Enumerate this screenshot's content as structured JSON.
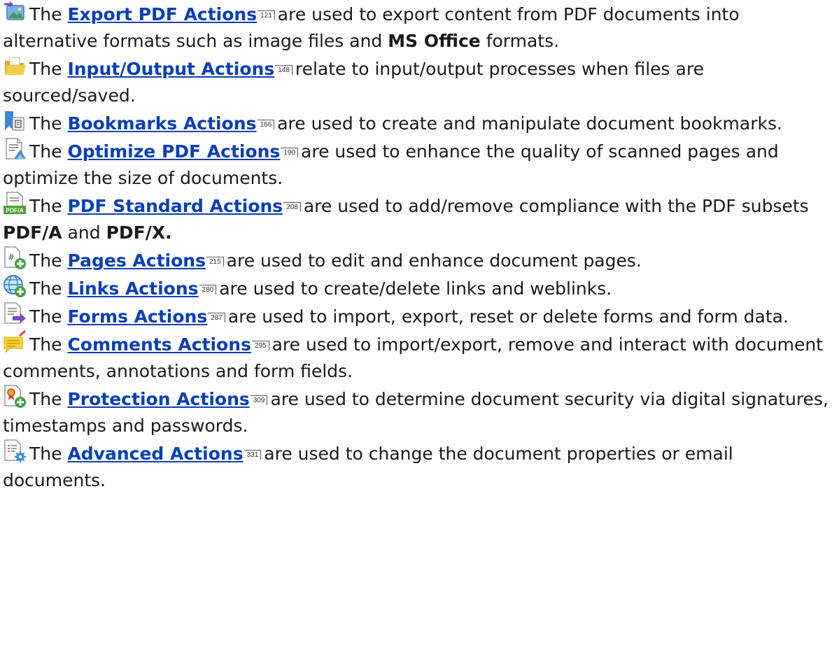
{
  "entries": [
    {
      "icon": "export-pdf-icon",
      "pre": "The ",
      "link": "Export PDF Actions",
      "page": "121",
      "text_a": "are used to export content from PDF documents into alternative formats such as image files and ",
      "bold_a": "MS Office",
      "text_b": " formats."
    },
    {
      "icon": "folder-icon",
      "pre": "The ",
      "link": "Input/Output Actions",
      "page": "148",
      "text_a": "relate to input/output processes when files are sourced/saved."
    },
    {
      "icon": "bookmark-icon",
      "pre": "The ",
      "link": "Bookmarks Actions",
      "page": "166",
      "text_a": "are used to create and manipulate document bookmarks."
    },
    {
      "icon": "optimize-pdf-icon",
      "pre": "The ",
      "link": "Optimize PDF Actions",
      "page": "190",
      "text_a": "are used to enhance the quality of scanned pages and optimize the size of documents."
    },
    {
      "icon": "pdfa-icon",
      "pre": "The ",
      "link": "PDF Standard Actions",
      "page": "208",
      "text_a": "are used to add/remove compliance with the PDF subsets ",
      "bold_a": "PDF/A",
      "text_b": " and ",
      "bold_b": "PDF/X."
    },
    {
      "icon": "page-add-icon",
      "pre": "The ",
      "link": "Pages Actions",
      "page": "215",
      "text_a": "are used to edit and enhance document pages."
    },
    {
      "icon": "globe-add-icon",
      "pre": "The ",
      "link": "Links Actions",
      "page": "280",
      "text_a": "are used to create/delete links and weblinks."
    },
    {
      "icon": "form-export-icon",
      "pre": "The ",
      "link": "Forms Actions",
      "page": "287",
      "text_a": "are used to import, export, reset or delete forms and form data."
    },
    {
      "icon": "comment-note-icon",
      "pre": "The ",
      "link": "Comments Actions",
      "page": "295",
      "text_a": "are used to import/export, remove and interact with document comments, annotations and form fields."
    },
    {
      "icon": "certificate-add-icon",
      "pre": "The ",
      "link": "Protection Actions",
      "page": "309",
      "text_a": "are used to determine document security via digital signatures, timestamps and passwords."
    },
    {
      "icon": "document-settings-icon",
      "pre": "The ",
      "link": "Advanced Actions",
      "page": "331",
      "text_a": "are used to change the document properties or email documents."
    }
  ]
}
